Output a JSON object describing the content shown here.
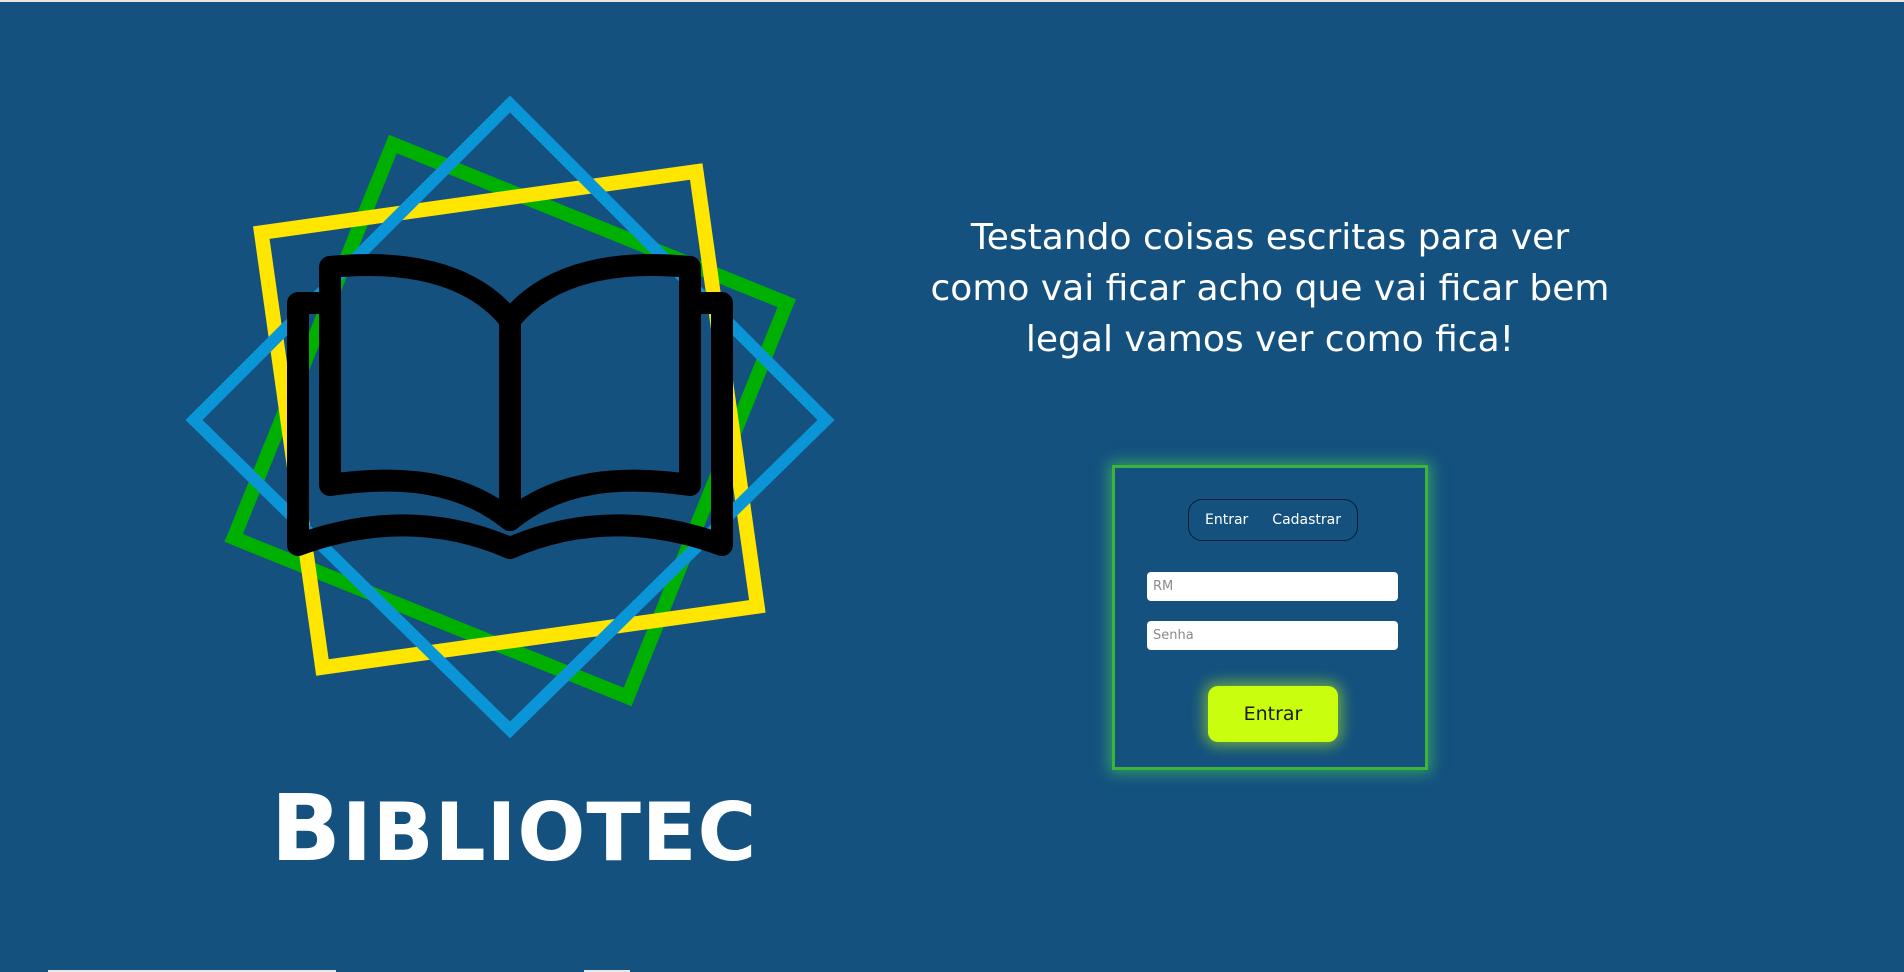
{
  "branding": {
    "logo_icon": "open-book-icon",
    "name": "Bibliotec"
  },
  "hero": {
    "tagline": "Testando coisas escritas para ver como vai ficar acho que vai ficar bem legal vamos ver como fica!"
  },
  "login": {
    "tabs": [
      {
        "label": "Entrar"
      },
      {
        "label": "Cadastrar"
      }
    ],
    "rm_placeholder": "RM",
    "senha_placeholder": "Senha",
    "submit_label": "Entrar"
  },
  "colors": {
    "background": "#14517f",
    "frame_green": "#00b000",
    "frame_yellow": "#ffe600",
    "frame_blue": "#0a96d6",
    "accent_button": "#c9ff0e",
    "card_border": "#3ab53a"
  }
}
